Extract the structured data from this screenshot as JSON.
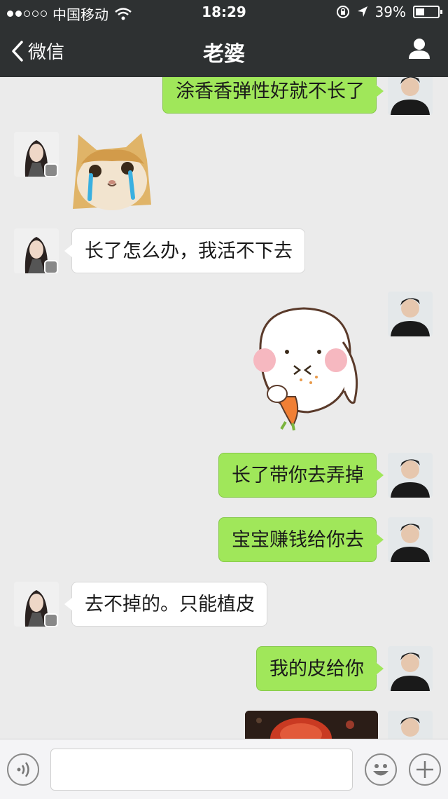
{
  "status_bar": {
    "carrier": "中国移动",
    "time": "18:29",
    "battery": "39%",
    "battery_level": 0.39,
    "signal_filled_dots": 2
  },
  "nav": {
    "back_label": "微信",
    "title": "老婆"
  },
  "messages": [
    {
      "from": "me",
      "type": "text",
      "text": "涂香香弹性好就不长了"
    },
    {
      "from": "her",
      "type": "sticker",
      "sticker": "crying-cat-sticker"
    },
    {
      "from": "her",
      "type": "text",
      "text": "长了怎么办，我活不下去"
    },
    {
      "from": "me",
      "type": "sticker",
      "sticker": "bunny-eating-carrot-sticker"
    },
    {
      "from": "me",
      "type": "text",
      "text": "长了带你去弄掉"
    },
    {
      "from": "me",
      "type": "text",
      "text": "宝宝赚钱给你去"
    },
    {
      "from": "her",
      "type": "text",
      "text": "去不掉的。只能植皮"
    },
    {
      "from": "me",
      "type": "text",
      "text": "我的皮给你"
    },
    {
      "from": "me",
      "type": "image",
      "image": "photo-image"
    }
  ],
  "input_bar": {
    "voice_icon": "voice-icon",
    "emoji_icon": "emoji-icon",
    "plus_icon": "plus-icon",
    "text_value": ""
  },
  "colors": {
    "nav_bg": "#2e3132",
    "chat_bg": "#ebebeb",
    "my_bubble": "#a0e75a",
    "her_bubble": "#ffffff"
  }
}
